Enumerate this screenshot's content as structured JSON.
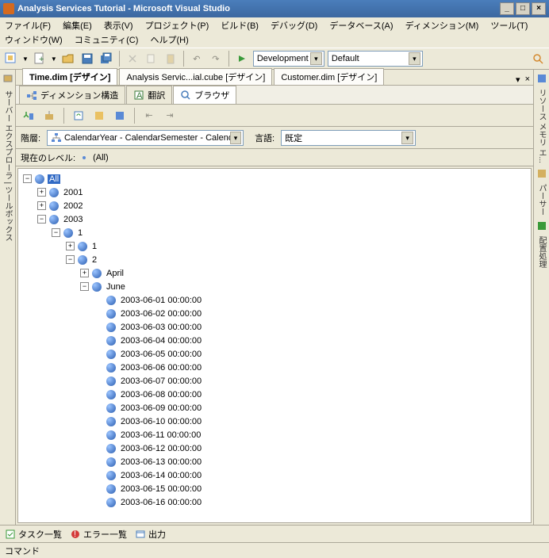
{
  "title": "Analysis Services Tutorial - Microsoft Visual Studio",
  "menus": {
    "file": "ファイル(F)",
    "edit": "編集(E)",
    "view": "表示(V)",
    "project": "プロジェクト(P)",
    "build": "ビルド(B)",
    "debug": "デバッグ(D)",
    "database": "データベース(A)",
    "dimension": "ディメンション(M)",
    "tool": "ツール(T)",
    "window": "ウィンドウ(W)",
    "community": "コミュニティ(C)",
    "help": "ヘルプ(H)"
  },
  "config": {
    "solution": "Development",
    "platform": "Default"
  },
  "doc_tabs": {
    "t1": "Time.dim [デザイン]",
    "t2": "Analysis Servic...ial.cube [デザイン]",
    "t3": "Customer.dim [デザイン]"
  },
  "sub_tabs": {
    "struct": "ディメンション構造",
    "trans": "翻訳",
    "browser": "ブラウザ"
  },
  "filter": {
    "hierarchy_label": "階層:",
    "hierarchy_value": "CalendarYear - CalendarSemester - Calendar(",
    "lang_label": "言語:",
    "lang_value": "既定"
  },
  "level": {
    "label": "現在のレベル:",
    "value": "(All)"
  },
  "tree": {
    "all": "All",
    "y2001": "2001",
    "y2002": "2002",
    "y2003": "2003",
    "s1": "1",
    "q1": "1",
    "q2": "2",
    "april": "April",
    "june": "June",
    "dates": [
      "2003-06-01 00:00:00",
      "2003-06-02 00:00:00",
      "2003-06-03 00:00:00",
      "2003-06-04 00:00:00",
      "2003-06-05 00:00:00",
      "2003-06-06 00:00:00",
      "2003-06-07 00:00:00",
      "2003-06-08 00:00:00",
      "2003-06-09 00:00:00",
      "2003-06-10 00:00:00",
      "2003-06-11 00:00:00",
      "2003-06-12 00:00:00",
      "2003-06-13 00:00:00",
      "2003-06-14 00:00:00",
      "2003-06-15 00:00:00",
      "2003-06-16 00:00:00"
    ]
  },
  "side": {
    "left": "サーバー エクスプローラ | ツールボックス"
  },
  "right": {
    "memory": "リソース メモリ エ...",
    "parser": "パーサー",
    "deploy": "配置処理"
  },
  "bottom": {
    "task": "タスク一覧",
    "error": "エラー一覧",
    "output": "出力"
  },
  "status": "コマンド"
}
